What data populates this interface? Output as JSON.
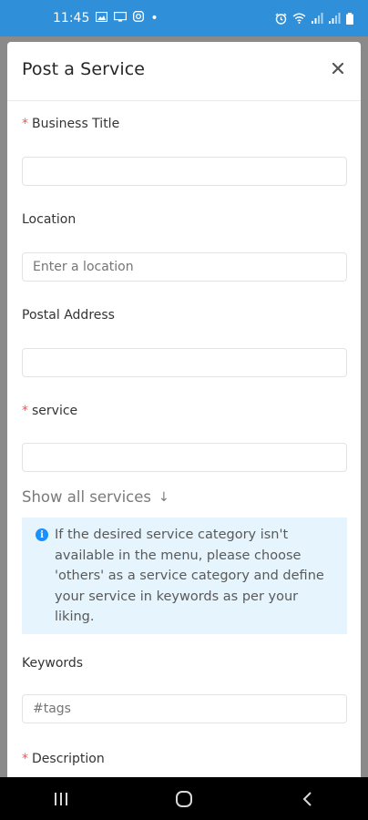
{
  "status_bar": {
    "time": "11:45",
    "dot": "•",
    "left_icons": [
      "gallery-icon",
      "cast-icon",
      "instagram-icon"
    ],
    "right_icons": [
      "alarm-icon",
      "wifi-icon",
      "signal-icon",
      "signal-icon",
      "battery-icon"
    ]
  },
  "modal": {
    "title": "Post a Service",
    "close_icon": "×"
  },
  "form": {
    "business_title": {
      "label": "Business Title",
      "required": true,
      "value": "",
      "placeholder": ""
    },
    "location": {
      "label": "Location",
      "required": false,
      "value": "",
      "placeholder": "Enter a location"
    },
    "postal_address": {
      "label": "Postal Address",
      "required": false,
      "value": "",
      "placeholder": ""
    },
    "service": {
      "label": "service",
      "required": true,
      "value": "",
      "placeholder": ""
    },
    "show_all_services": "Show all services",
    "show_all_arrow": "↓",
    "info": "If the desired service category isn't available in the menu, please choose 'others' as a service category and define your service in keywords as per your liking.",
    "keywords": {
      "label": "Keywords",
      "required": false,
      "value": "",
      "placeholder": "#tags"
    },
    "description": {
      "label": "Description",
      "required": true
    }
  },
  "colors": {
    "status_bar": "#2f8fd8",
    "required_asterisk": "#ff4d4f",
    "info_bg": "#e6f5fd",
    "info_icon": "#1890ff"
  },
  "nav_bar": {
    "buttons": [
      "recent-apps-icon",
      "home-icon",
      "back-icon"
    ]
  }
}
